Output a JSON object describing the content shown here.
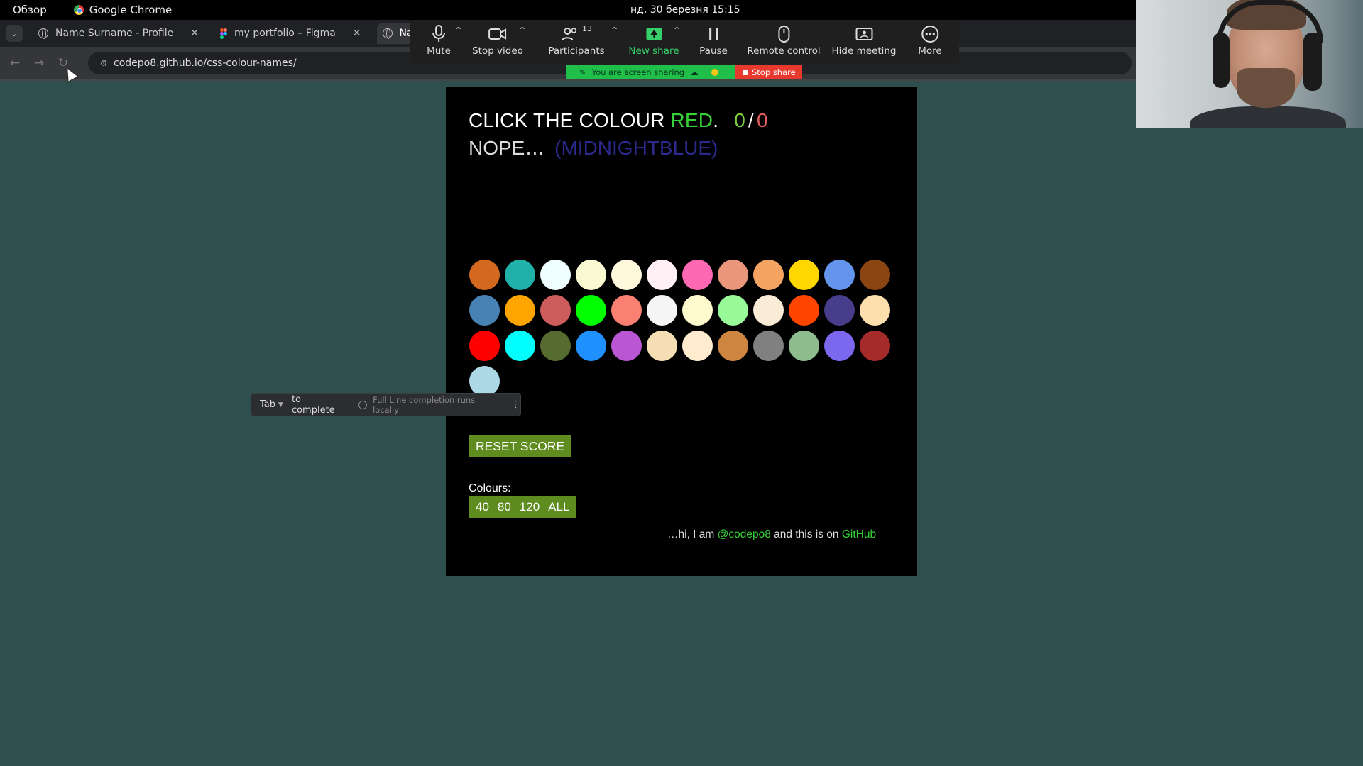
{
  "os": {
    "overview_label": "Обзор",
    "app_name": "Google Chrome",
    "clock": "нд, 30 березня  15:15"
  },
  "browser": {
    "tabs": [
      {
        "title": "Name Surname - Profile",
        "icon": "globe-icon",
        "active": false
      },
      {
        "title": "my portfolio – Figma",
        "icon": "figma-icon",
        "active": false
      },
      {
        "title": "Nam",
        "icon": "globe-icon",
        "active": true
      }
    ],
    "url": "codepo8.github.io/css-colour-names/"
  },
  "zoom": {
    "buttons": [
      {
        "label": "Mute",
        "icon": "microphone-icon"
      },
      {
        "label": "Stop video",
        "icon": "video-camera-icon"
      },
      {
        "label": "Participants",
        "icon": "participants-icon",
        "badge": "13"
      },
      {
        "label": "New share",
        "icon": "share-screen-icon"
      },
      {
        "label": "Pause",
        "icon": "pause-icon"
      },
      {
        "label": "Remote control",
        "icon": "mouse-icon"
      },
      {
        "label": "Hide meeting",
        "icon": "hide-meeting-icon"
      },
      {
        "label": "More",
        "icon": "more-icon"
      }
    ],
    "sharing_text": "You are screen sharing",
    "stop_share_label": "Stop share",
    "share_color": "#36d06a"
  },
  "game": {
    "prompt": "CLICK THE COLOUR",
    "target_colour": "RED",
    "target_suffix": ".",
    "score_correct": "0",
    "score_wrong": "0",
    "feedback": "NOPE…",
    "last_pick": "(MIDNIGHTBLUE)",
    "swatches": [
      "#d2691e",
      "#20b2aa",
      "#f0ffff",
      "#fafad2",
      "#fff8dc",
      "#fff0f5",
      "#ff69b4",
      "#e9967a",
      "#f4a460",
      "#ffd700",
      "#6495ed",
      "#8b4513",
      "#4682b4",
      "#ffa500",
      "#cd5c5c",
      "#00ff00",
      "#fa8072",
      "#f5f5f5",
      "#fffacd",
      "#98fb98",
      "#faebd7",
      "#ff4500",
      "#483d8b",
      "#ffdead",
      "#ff0000",
      "#00ffff",
      "#556b2f",
      "#1e90ff",
      "#ba55d3",
      "#f5deb3",
      "#ffebcd",
      "#cd853f",
      "#808080",
      "#8fbc8f",
      "#7b68ee",
      "#a52a2a",
      "#add8e6"
    ],
    "reset_label": "RESET SCORE",
    "colours_label": "Colours:",
    "colour_counts": [
      "40",
      "80",
      "120",
      "ALL"
    ],
    "footer_pre": "…hi, I am",
    "footer_handle": "@codepo8",
    "footer_mid": "and this is on",
    "footer_link": "GitHub"
  },
  "completion_hint": {
    "key": "Tab",
    "action": "to complete",
    "note": "Full Line completion runs locally"
  }
}
